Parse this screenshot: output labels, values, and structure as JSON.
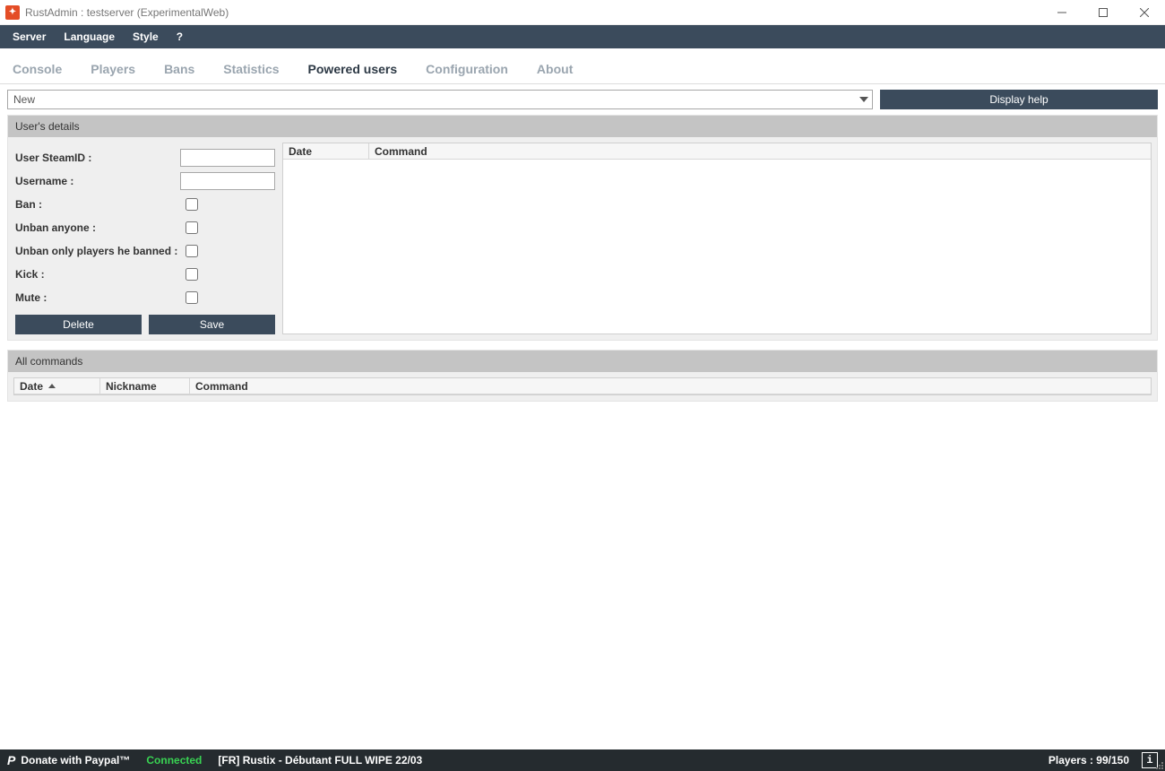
{
  "window": {
    "title": "RustAdmin  : testserver (ExperimentalWeb)"
  },
  "menubar": {
    "items": [
      "Server",
      "Language",
      "Style",
      "?"
    ]
  },
  "tabs": {
    "items": [
      "Console",
      "Players",
      "Bans",
      "Statistics",
      "Powered users",
      "Configuration",
      "About"
    ],
    "active_index": 4
  },
  "toprow": {
    "dropdown_value": "New",
    "help_button_label": "Display help"
  },
  "details_panel": {
    "header": "User's details",
    "fields": {
      "steamid_label": "User SteamID :",
      "username_label": "Username :",
      "ban_label": "Ban :",
      "unban_anyone_label": "Unban anyone :",
      "unban_own_label": "Unban only players he banned :",
      "kick_label": "Kick :",
      "mute_label": "Mute :"
    },
    "buttons": {
      "delete": "Delete",
      "save": "Save"
    },
    "grid_headers": {
      "date": "Date",
      "command": "Command"
    }
  },
  "commands_panel": {
    "header": "All commands",
    "grid_headers": {
      "date": "Date",
      "nickname": "Nickname",
      "command": "Command"
    }
  },
  "footer": {
    "donate": "Donate with Paypal™",
    "connected": "Connected",
    "server_name": "[FR] Rustix - Débutant FULL WIPE 22/03",
    "players": "Players : 99/150",
    "info_symbol": "i"
  }
}
